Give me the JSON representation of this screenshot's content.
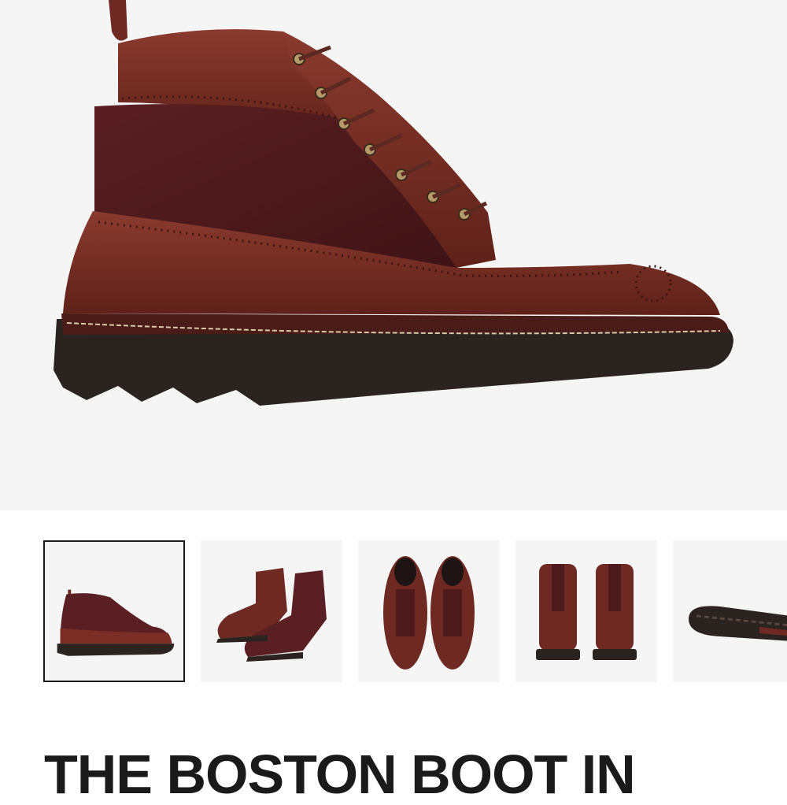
{
  "product": {
    "title": "THE BOSTON BOOT IN",
    "colors": {
      "leather": "#6e2a22",
      "leather_light": "#8a3a2e",
      "suede": "#4e1a1e",
      "sole": "#2a2320",
      "stitch": "#d8c9a8",
      "background": "#f5f5f5",
      "selected_border": "#1a1a1a"
    }
  },
  "gallery": {
    "main_image": "boot-side-view",
    "thumbnails": [
      {
        "view": "side",
        "selected": true
      },
      {
        "view": "pair-angled",
        "selected": false
      },
      {
        "view": "top",
        "selected": false
      },
      {
        "view": "back",
        "selected": false
      },
      {
        "view": "sole",
        "selected": false
      }
    ]
  }
}
